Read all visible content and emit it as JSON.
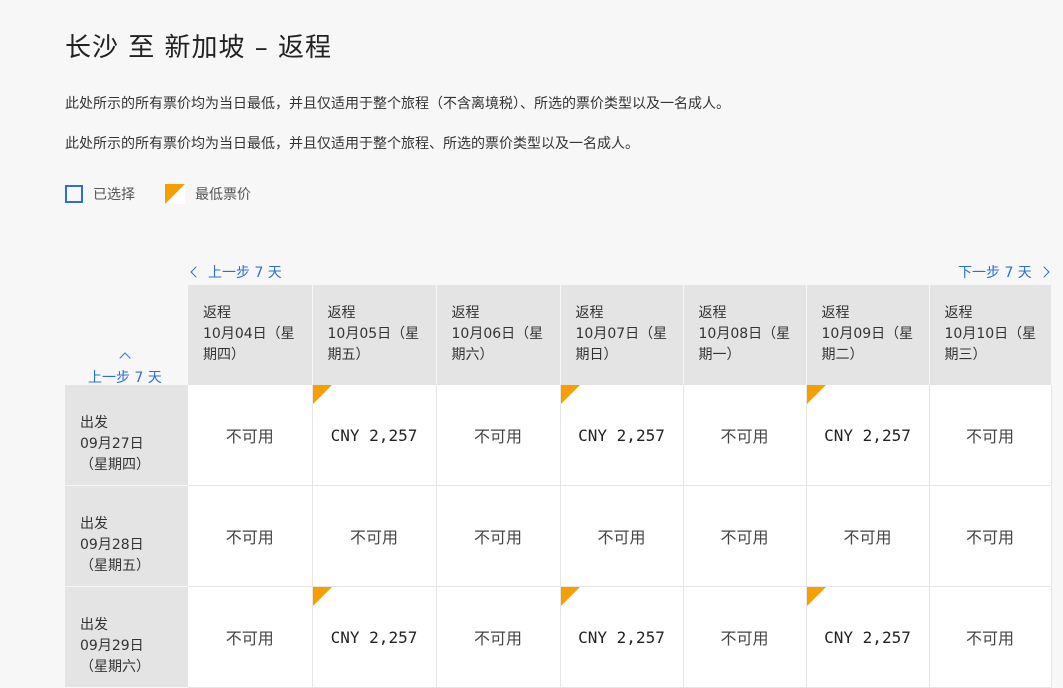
{
  "page": {
    "title": "长沙 至 新加坡 – 返程",
    "note1": "此处所示的所有票价均为当日最低，并且仅适用于整个旅程（不含离境税）、所选的票价类型以及一名成人。",
    "note2": "此处所示的所有票价均为当日最低，并且仅适用于整个旅程、所选的票价类型以及一名成人。"
  },
  "legend": {
    "selected": "已选择",
    "lowest": "最低票价"
  },
  "nav": {
    "prev_week_top": "上一步 7 天",
    "next_week_top": "下一步 7 天",
    "prev_week_left": "上一步 7 天"
  },
  "colors": {
    "accent": "#2b6fd6",
    "lowest_flag": "#f5a000",
    "header_bg": "#e4e4e4"
  },
  "columns": [
    {
      "type": "返程",
      "date": "10月04日（星期四）"
    },
    {
      "type": "返程",
      "date": "10月05日（星期五）"
    },
    {
      "type": "返程",
      "date": "10月06日（星期六）"
    },
    {
      "type": "返程",
      "date": "10月07日（星期日）"
    },
    {
      "type": "返程",
      "date": "10月08日（星期一）"
    },
    {
      "type": "返程",
      "date": "10月09日（星期二）"
    },
    {
      "type": "返程",
      "date": "10月10日（星期三）"
    }
  ],
  "rows": [
    {
      "type": "出发",
      "date": "09月27日（星期四）",
      "cells": [
        {
          "text": "不可用",
          "lowest": false
        },
        {
          "text": "CNY 2,257",
          "lowest": true
        },
        {
          "text": "不可用",
          "lowest": false
        },
        {
          "text": "CNY 2,257",
          "lowest": true
        },
        {
          "text": "不可用",
          "lowest": false
        },
        {
          "text": "CNY 2,257",
          "lowest": true
        },
        {
          "text": "不可用",
          "lowest": false
        }
      ]
    },
    {
      "type": "出发",
      "date": "09月28日（星期五）",
      "cells": [
        {
          "text": "不可用",
          "lowest": false
        },
        {
          "text": "不可用",
          "lowest": false
        },
        {
          "text": "不可用",
          "lowest": false
        },
        {
          "text": "不可用",
          "lowest": false
        },
        {
          "text": "不可用",
          "lowest": false
        },
        {
          "text": "不可用",
          "lowest": false
        },
        {
          "text": "不可用",
          "lowest": false
        }
      ]
    },
    {
      "type": "出发",
      "date": "09月29日（星期六）",
      "cells": [
        {
          "text": "不可用",
          "lowest": false
        },
        {
          "text": "CNY 2,257",
          "lowest": true
        },
        {
          "text": "不可用",
          "lowest": false
        },
        {
          "text": "CNY 2,257",
          "lowest": true
        },
        {
          "text": "不可用",
          "lowest": false
        },
        {
          "text": "CNY 2,257",
          "lowest": true
        },
        {
          "text": "不可用",
          "lowest": false
        }
      ]
    }
  ]
}
